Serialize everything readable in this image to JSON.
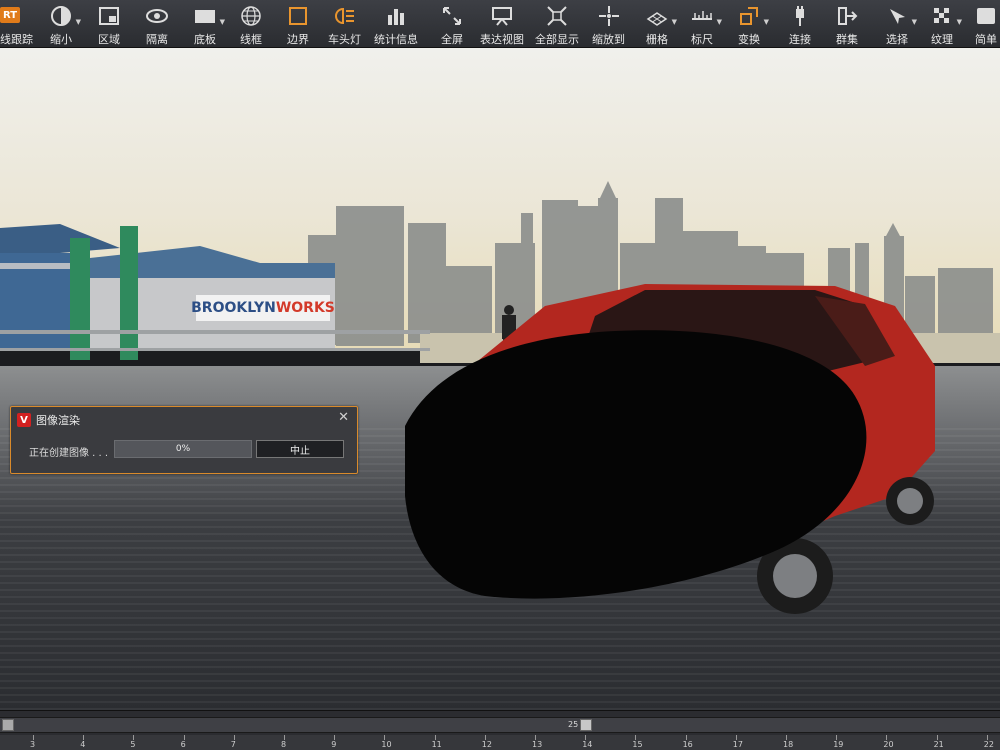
{
  "toolbar": {
    "badge": "RT",
    "items": [
      {
        "label": "线跟踪",
        "icon": "raytrace-icon"
      },
      {
        "label": "缩小",
        "icon": "shrink-icon"
      },
      {
        "label": "区域",
        "icon": "region-icon"
      },
      {
        "label": "隔离",
        "icon": "isolate-eye-icon"
      },
      {
        "label": "底板",
        "icon": "baseplate-icon"
      },
      {
        "label": "线框",
        "icon": "wireframe-globe-icon"
      },
      {
        "label": "边界",
        "icon": "boundary-icon"
      },
      {
        "label": "车头灯",
        "icon": "headlight-icon"
      },
      {
        "label": "统计信息",
        "icon": "statistics-icon"
      },
      {
        "label": "全屏",
        "icon": "fullscreen-icon"
      },
      {
        "label": "表达视图",
        "icon": "presentation-view-icon"
      },
      {
        "label": "全部显示",
        "icon": "show-all-icon"
      },
      {
        "label": "缩放到",
        "icon": "zoom-to-icon"
      },
      {
        "label": "栅格",
        "icon": "grid-icon"
      },
      {
        "label": "标尺",
        "icon": "ruler-icon"
      },
      {
        "label": "变换",
        "icon": "transform-icon"
      },
      {
        "label": "连接",
        "icon": "connect-icon"
      },
      {
        "label": "群集",
        "icon": "cluster-icon"
      },
      {
        "label": "选择",
        "icon": "select-icon"
      },
      {
        "label": "纹理",
        "icon": "texture-icon"
      },
      {
        "label": "简单",
        "icon": "simple-icon"
      }
    ]
  },
  "scene": {
    "sign_text": "BROOKLYNWORKS",
    "sign_part1": "BROOKLYN",
    "sign_part2": "WORKS"
  },
  "dialog": {
    "title": "图像渲染",
    "logo": "V",
    "status": "正在创建图像 . . .",
    "progress_value": 0,
    "progress_label": "0%",
    "stop_button": "中止",
    "close": "✕"
  },
  "timeline": {
    "current_frame": "25",
    "ticks": [
      "3",
      "4",
      "5",
      "6",
      "7",
      "8",
      "9",
      "10",
      "11",
      "12",
      "13",
      "14",
      "15",
      "16",
      "17",
      "18",
      "19",
      "20",
      "21",
      "22"
    ]
  },
  "colors": {
    "accent": "#d98a2b",
    "toolbar_bg": "#2f3135",
    "dialog_bg": "#3a3b3f"
  }
}
